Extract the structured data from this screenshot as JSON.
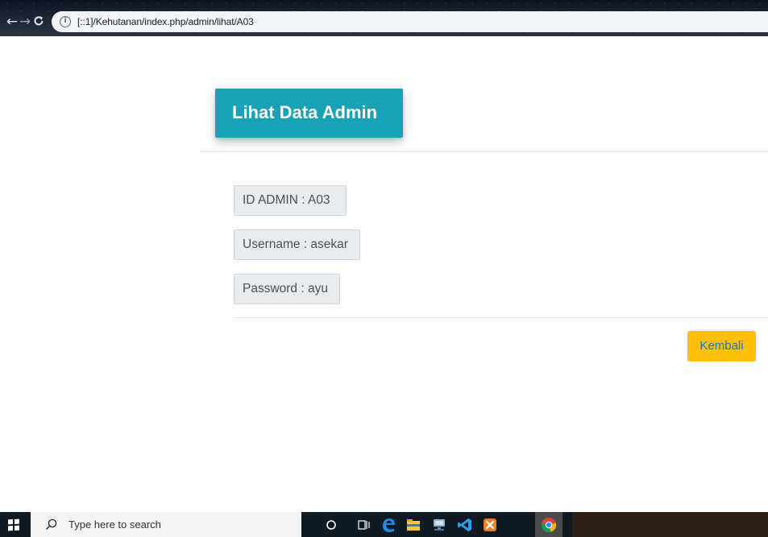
{
  "browser": {
    "url": "[::1]/Kehutanan/index.php/admin/lihat/A03",
    "back_glyph": "←",
    "forward_glyph": "→",
    "info_glyph": "i"
  },
  "page": {
    "title": "Lihat Data Admin",
    "fields": {
      "id_admin": "ID ADMIN : A03",
      "username": "Username : asekar",
      "password": "Password : ayu"
    },
    "back_button_label": "Kembali"
  },
  "taskbar": {
    "search_placeholder": "Type here to search",
    "apps": [
      "cortana-icon",
      "task-view-icon",
      "edge-icon",
      "file-explorer-icon",
      "network-app-icon",
      "vscode-icon",
      "xampp-icon",
      "chrome-icon"
    ]
  },
  "colors": {
    "header_bg": "#17a2b8",
    "button_bg": "#ffc107",
    "button_text": "#1a73c9",
    "field_bg": "#e9ecef",
    "taskbar_bg": "#101a22"
  }
}
